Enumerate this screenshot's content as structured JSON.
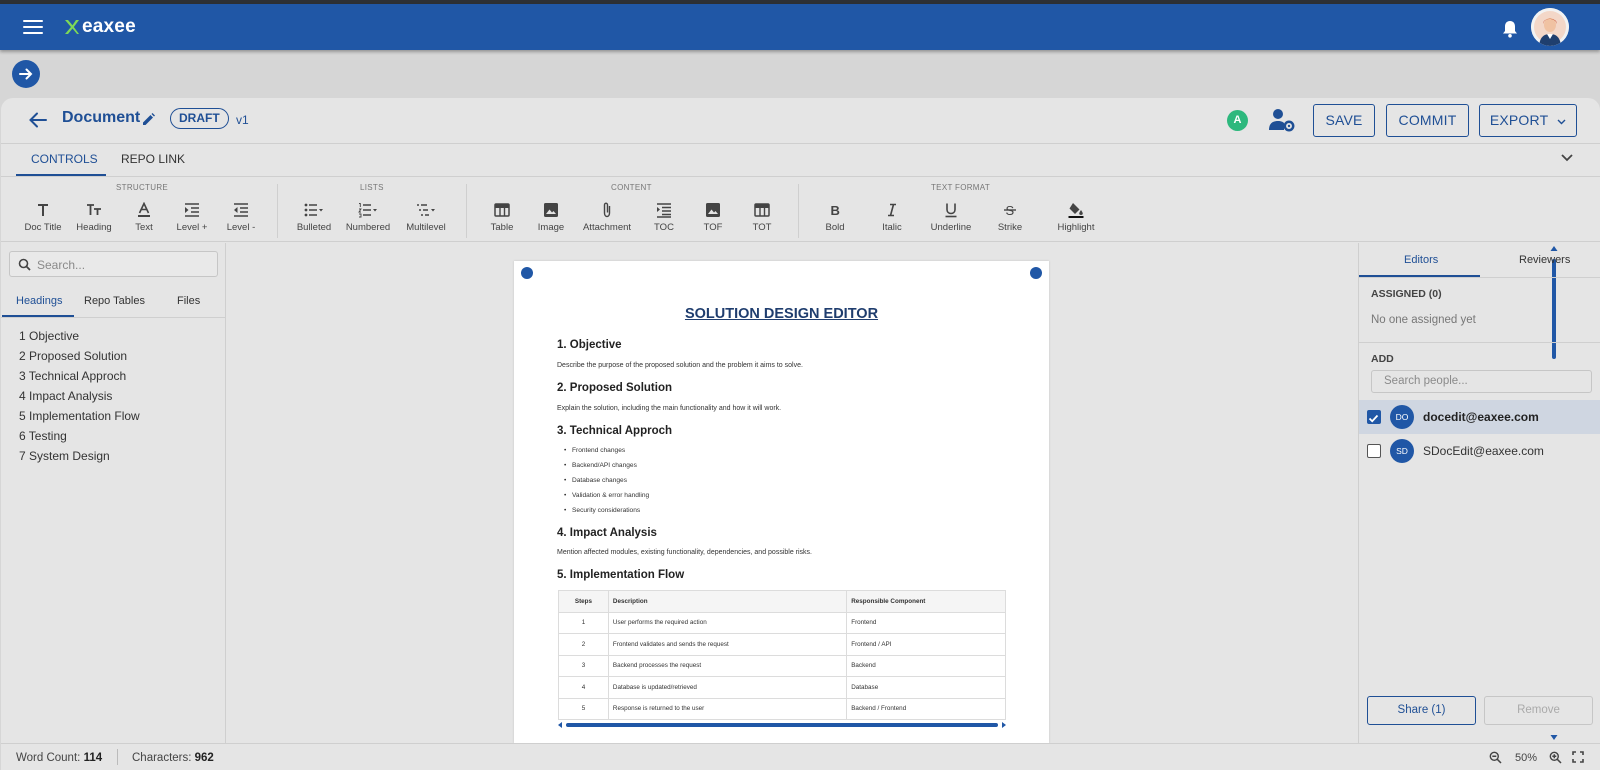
{
  "app": {
    "name": "eaxee"
  },
  "header": {
    "title": "Document",
    "status_badge": "DRAFT",
    "version": "v1",
    "user_initial": "A",
    "buttons": {
      "save": "SAVE",
      "commit": "COMMIT",
      "export": "EXPORT"
    }
  },
  "tabs": [
    {
      "label": "CONTROLS",
      "active": true
    },
    {
      "label": "REPO LINK",
      "active": false
    }
  ],
  "toolbar": {
    "groups": [
      {
        "label": "STRUCTURE",
        "tools": [
          "Doc Title",
          "Heading",
          "Text",
          "Level +",
          "Level -"
        ]
      },
      {
        "label": "LISTS",
        "tools": [
          "Bulleted",
          "Numbered",
          "Multilevel"
        ]
      },
      {
        "label": "CONTENT",
        "tools": [
          "Table",
          "Image",
          "Attachment",
          "TOC",
          "TOF",
          "TOT"
        ]
      },
      {
        "label": "TEXT FORMAT",
        "tools": [
          "Bold",
          "Italic",
          "Underline",
          "Strike",
          "Highlight"
        ]
      }
    ]
  },
  "left_panel": {
    "search_placeholder": "Search...",
    "tabs": [
      "Headings",
      "Repo Tables",
      "Files"
    ],
    "outline": [
      "1 Objective",
      "2 Proposed Solution",
      "3 Technical Approch",
      "4 Impact Analysis",
      "5 Implementation Flow",
      "6 Testing",
      "7 System Design"
    ]
  },
  "document": {
    "title": "SOLUTION DESIGN EDITOR",
    "sections": {
      "s1": {
        "heading": "1.  Objective",
        "text": "Describe the purpose of the proposed solution and the problem it aims to solve."
      },
      "s2": {
        "heading": "2.  Proposed Solution",
        "text": "Explain the solution, including the main functionality and how it will work."
      },
      "s3": {
        "heading": "3.  Technical Approch",
        "bullets": [
          "Frontend changes",
          "Backend/API changes",
          "Database changes",
          "Validation & error handling",
          "Security considerations"
        ]
      },
      "s4": {
        "heading": "4.  Impact Analysis",
        "text": "Mention affected modules, existing functionality, dependencies, and possible risks."
      },
      "s5": {
        "heading": "5.  Implementation Flow"
      }
    },
    "table": {
      "headers": [
        "Steps",
        "Description",
        "Responsible Component"
      ],
      "rows": [
        [
          "1",
          "User performs the required action",
          "Frontend"
        ],
        [
          "2",
          "Frontend validates and sends the request",
          "Frontend / API"
        ],
        [
          "3",
          "Backend processes the request",
          "Backend"
        ],
        [
          "4",
          "Database is updated/retrieved",
          "Database"
        ],
        [
          "5",
          "Response is returned to the user",
          "Backend / Frontend"
        ]
      ]
    }
  },
  "right_panel": {
    "tabs": [
      "Editors",
      "Reviewers"
    ],
    "assigned_label": "ASSIGNED (0)",
    "empty_text": "No one assigned yet",
    "add_label": "ADD",
    "search_placeholder": "Search people...",
    "people": [
      {
        "initials": "DO",
        "email": "docedit@eaxee.com",
        "checked": true
      },
      {
        "initials": "SD",
        "email": "SDocEdit@eaxee.com",
        "checked": false
      }
    ],
    "share_button": "Share (1)",
    "remove_button": "Remove"
  },
  "status_bar": {
    "word_count_label": "Word Count:",
    "word_count": "114",
    "characters_label": "Characters:",
    "characters": "962",
    "zoom": "50%"
  },
  "colors": {
    "primary": "#2057a6",
    "brand_green": "#2db87d",
    "background": "#e5e5e5"
  }
}
